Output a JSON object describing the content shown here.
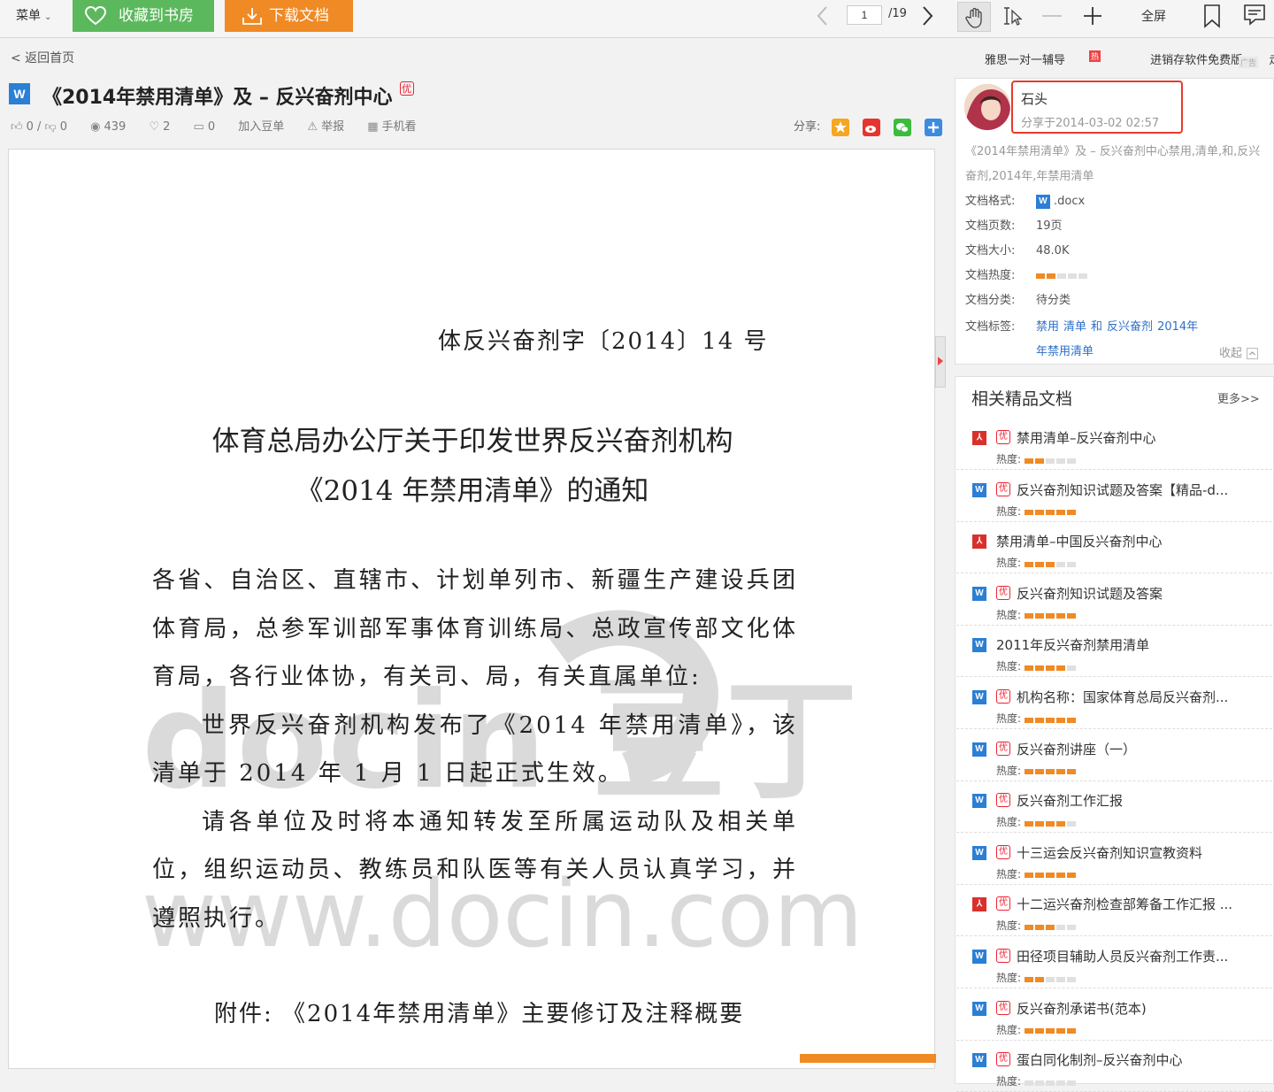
{
  "toolbar": {
    "menu_label": "菜单",
    "collect_label": "收藏到书房",
    "download_label": "下载文档",
    "current_page": "1",
    "total_pages": "/19",
    "fullscreen_label": "全屏"
  },
  "header": {
    "back_label": "< 返回首页",
    "doc_icon_letter": "W",
    "title": "《2014年禁用清单》及 – 反兴奋剂中心",
    "badge": "优",
    "stats": {
      "likes": "0 /",
      "dislikes": "0",
      "views": "439",
      "favorites": "2",
      "comments": "0",
      "add_to_list": "加入豆单",
      "report": "举报",
      "mobile_view": "手机看"
    },
    "share_label": "分享:"
  },
  "document": {
    "doc_number": "体反兴奋剂字〔2014〕14 号",
    "heading_line1": "体育总局办公厅关于印发世界反兴奋剂机构",
    "heading_line2": "《2014 年禁用清单》的通知",
    "para1": "各省、自治区、直辖市、计划单列市、新疆生产建设兵团体育局，总参军训部军事体育训练局、总政宣传部文化体育局，各行业体协，有关司、局，有关直属单位:",
    "para2": "世界反兴奋剂机构发布了《2014 年禁用清单》，该清单于 2014 年 1 月 1 日起正式生效。",
    "para3": "请各单位及时将本通知转发至所属运动队及相关单位，组织运动员、教练员和队医等有关人员认真学习，并遵照执行。",
    "attachment": "附件: 《2014年禁用清单》主要修订及注释概要",
    "watermark_logo": "docin 豆丁",
    "watermark_url": "www.docin.com"
  },
  "sidebar": {
    "top_links": [
      "雅思一对一辅导",
      "进销存软件免费版",
      "走骨"
    ],
    "hot_tag": "热",
    "ad_tag": "广告",
    "uploader_name": "石头",
    "uploader_date": "分享于2014-03-02 02:57",
    "description": "《2014年禁用清单》及 – 反兴奋剂中心禁用,清单,和,反兴奋剂,2014年,年禁用清单",
    "meta": {
      "format_key": "文档格式:",
      "format_value": ".docx",
      "pages_key": "文档页数:",
      "pages_value": "19页",
      "size_key": "文档大小:",
      "size_value": "48.0K",
      "heat_key": "文档热度:",
      "heat_level": 2,
      "category_key": "文档分类:",
      "category_value": "待分类",
      "tags_key": "文档标签:",
      "tags": [
        "禁用",
        "清单",
        "和",
        "反兴奋剂",
        "2014年",
        "年禁用清单"
      ],
      "collapse_label": "收起"
    },
    "related": {
      "title": "相关精品文档",
      "more_label": "更多>>",
      "heat_label": "热度:",
      "items": [
        {
          "type": "pdf",
          "premium": true,
          "name": "禁用清单–反兴奋剂中心",
          "heat": 2
        },
        {
          "type": "w",
          "premium": true,
          "name": "反兴奋剂知识试题及答案【精品-d...",
          "heat": 5
        },
        {
          "type": "pdf",
          "premium": false,
          "name": "禁用清单–中国反兴奋剂中心",
          "heat": 3
        },
        {
          "type": "w",
          "premium": true,
          "name": "反兴奋剂知识试题及答案",
          "heat": 5
        },
        {
          "type": "w",
          "premium": false,
          "name": "2011年反兴奋剂禁用清单",
          "heat": 4
        },
        {
          "type": "w",
          "premium": true,
          "name": "机构名称：国家体育总局反兴奋剂...",
          "heat": 5
        },
        {
          "type": "w",
          "premium": true,
          "name": "反兴奋剂讲座（一）",
          "heat": 5
        },
        {
          "type": "w",
          "premium": true,
          "name": "反兴奋剂工作汇报",
          "heat": 4
        },
        {
          "type": "w",
          "premium": true,
          "name": "十三运会反兴奋剂知识宣教资料",
          "heat": 5
        },
        {
          "type": "pdf",
          "premium": true,
          "name": "十二运兴奋剂检查部筹备工作汇报 ...",
          "heat": 3
        },
        {
          "type": "w",
          "premium": true,
          "name": "田径项目辅助人员反兴奋剂工作责...",
          "heat": 2
        },
        {
          "type": "w",
          "premium": true,
          "name": "反兴奋剂承诺书(范本)",
          "heat": 5
        },
        {
          "type": "w",
          "premium": true,
          "name": "蛋白同化制剂–反兴奋剂中心",
          "heat": 0
        }
      ]
    }
  },
  "colors": {
    "collect_green": "#5cb85c",
    "download_orange": "#f08a24",
    "link_blue": "#2c6fc8",
    "highlight_red": "#e53b2c"
  }
}
